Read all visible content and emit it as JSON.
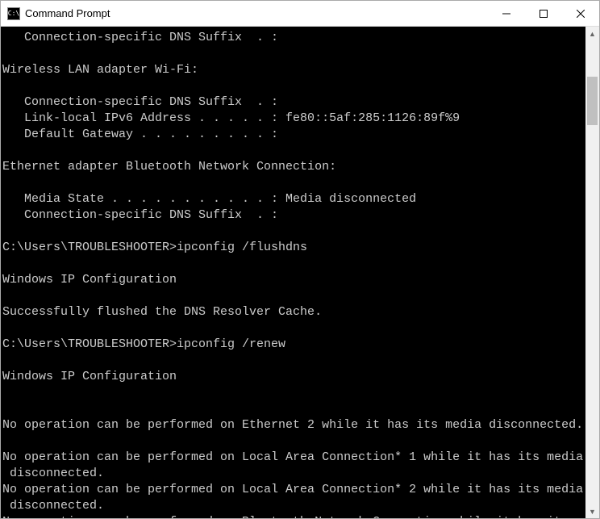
{
  "window": {
    "title": "Command Prompt"
  },
  "console": {
    "lines": [
      "   Connection-specific DNS Suffix  . :",
      "",
      "Wireless LAN adapter Wi-Fi:",
      "",
      "   Connection-specific DNS Suffix  . :",
      "   Link-local IPv6 Address . . . . . : fe80::5af:285:1126:89f%9",
      "   Default Gateway . . . . . . . . . :",
      "",
      "Ethernet adapter Bluetooth Network Connection:",
      "",
      "   Media State . . . . . . . . . . . : Media disconnected",
      "   Connection-specific DNS Suffix  . :",
      "",
      "C:\\Users\\TROUBLESHOOTER>ipconfig /flushdns",
      "",
      "Windows IP Configuration",
      "",
      "Successfully flushed the DNS Resolver Cache.",
      "",
      "C:\\Users\\TROUBLESHOOTER>ipconfig /renew",
      "",
      "Windows IP Configuration",
      "",
      "",
      "No operation can be performed on Ethernet 2 while it has its media disconnected.",
      "",
      "No operation can be performed on Local Area Connection* 1 while it has its media",
      " disconnected.",
      "No operation can be performed on Local Area Connection* 2 while it has its media",
      " disconnected.",
      "No operation can be performed on Bluetooth Network Connection while it has its m"
    ]
  }
}
